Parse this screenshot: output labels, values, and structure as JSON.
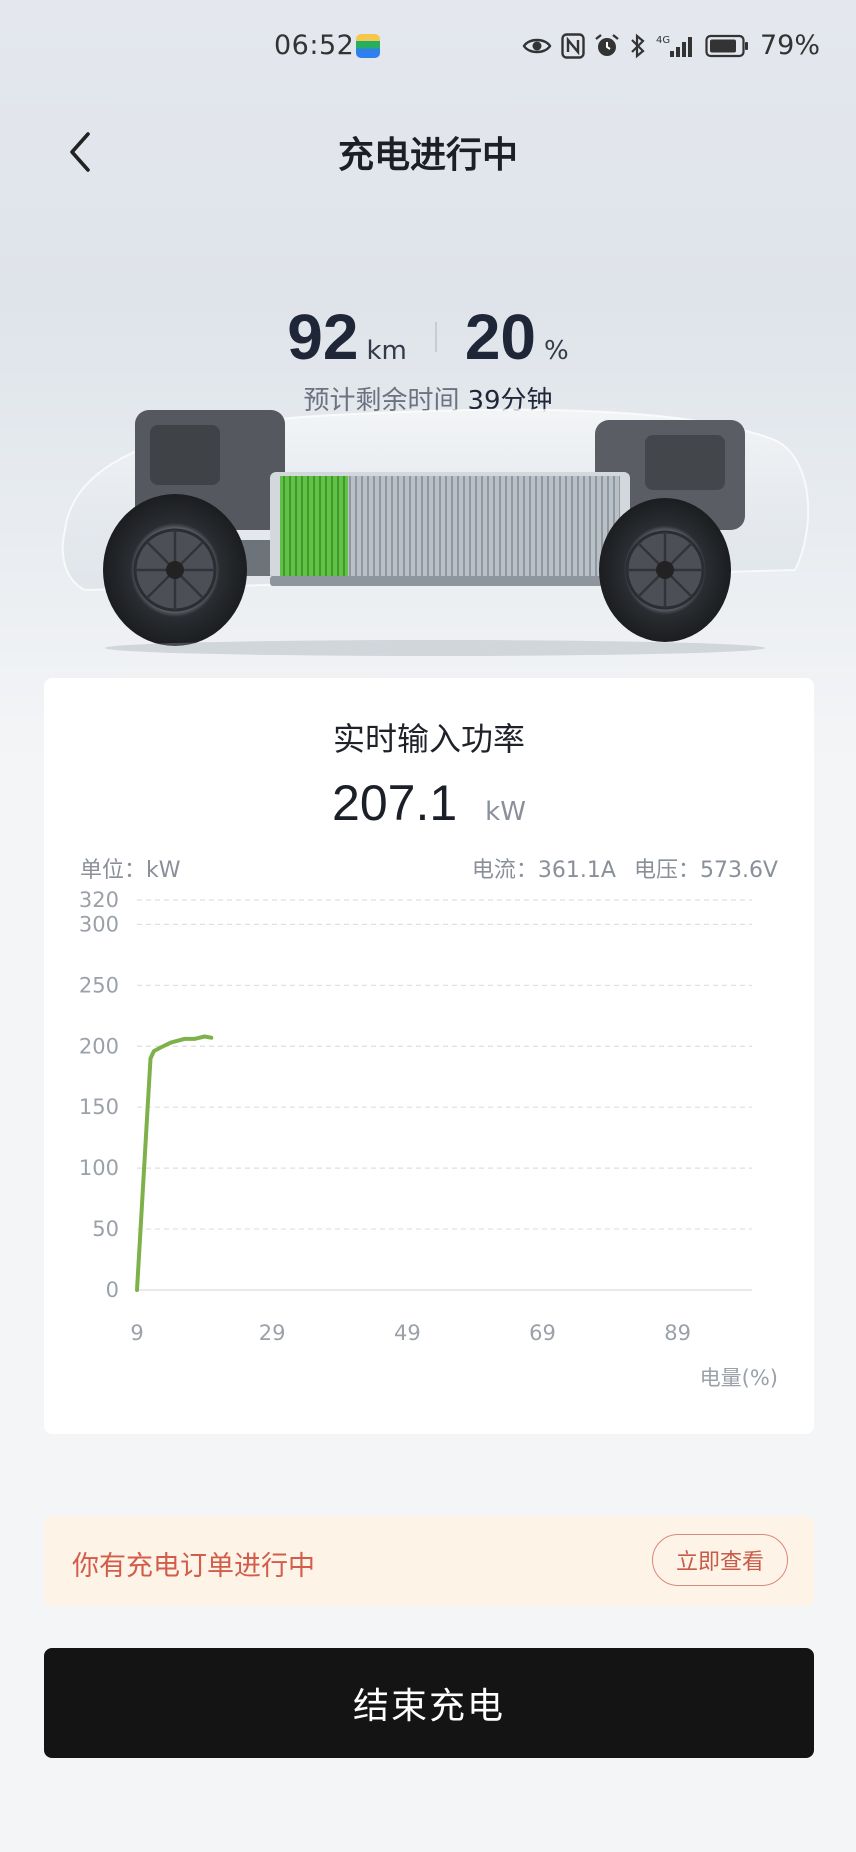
{
  "status_bar": {
    "time": "06:52",
    "battery_percent": "79%",
    "network": "4G",
    "icons": [
      "app-icon",
      "eye-icon",
      "nfc-icon",
      "alarm-icon",
      "bluetooth-icon",
      "signal-icon",
      "battery-icon"
    ]
  },
  "header": {
    "title": "充电进行中",
    "back_icon": "chevron-left-icon"
  },
  "stats": {
    "range_value": "92",
    "range_unit": "km",
    "soc_value": "20",
    "soc_unit": "%",
    "eta_label": "预计剩余时间",
    "eta_value": "39分钟"
  },
  "battery_fill_fraction": 0.2,
  "power_card": {
    "title": "实时输入功率",
    "value": "207.1",
    "unit": "kW",
    "unit_label": "单位：kW",
    "current": "电流：361.1A",
    "voltage": "电压：573.6V"
  },
  "chart_data": {
    "type": "line",
    "title": "",
    "xlabel": "电量(%)",
    "ylabel": "",
    "x_ticks": [
      9,
      29,
      49,
      69,
      89
    ],
    "y_ticks": [
      0,
      50,
      100,
      150,
      200,
      250,
      300,
      320
    ],
    "xlim": [
      9,
      100
    ],
    "ylim": [
      0,
      320
    ],
    "grid": true,
    "series": [
      {
        "color": "#7fb14a",
        "x": [
          9,
          11,
          11.5,
          12.5,
          14,
          16,
          17.5,
          19,
          20
        ],
        "y": [
          0,
          190,
          196,
          199,
          203,
          206,
          206,
          208,
          207
        ]
      }
    ]
  },
  "order_banner": {
    "text": "你有充电订单进行中",
    "button": "立即查看"
  },
  "end_button": {
    "label": "结束充电"
  },
  "colors": {
    "accent_green": "#7fb14a",
    "battery_green": "#5cbf3f",
    "banner_bg": "#fdf3e7",
    "banner_text": "#d25d4a",
    "primary_button": "#141414"
  }
}
